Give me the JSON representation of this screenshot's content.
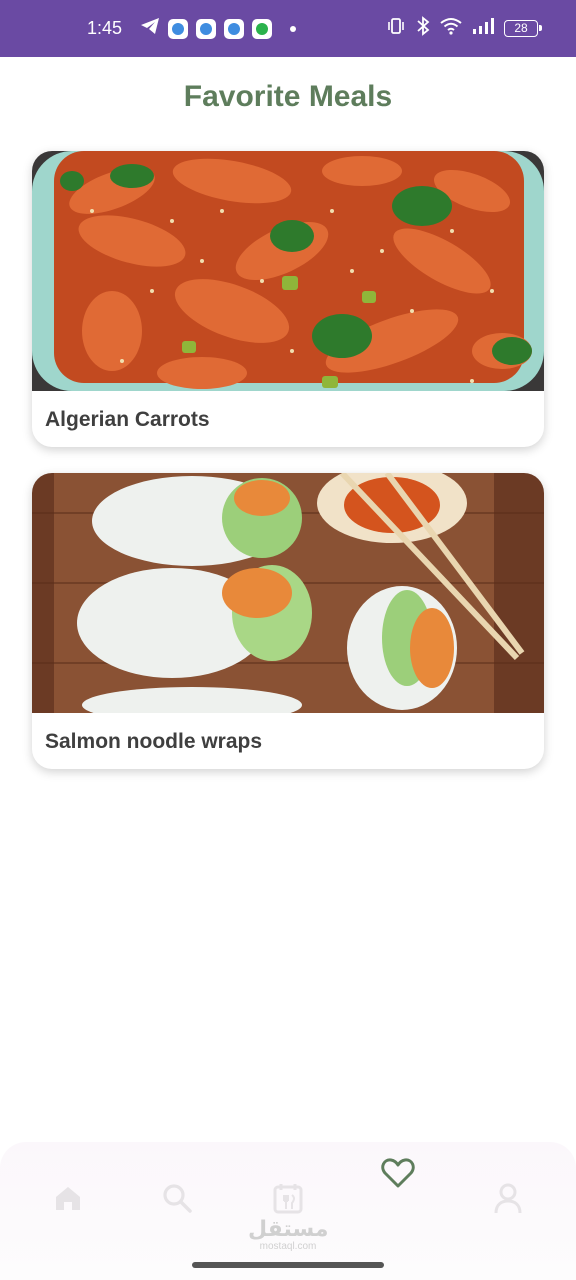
{
  "status_bar": {
    "time": "1:45",
    "battery": "28",
    "icons": [
      "telegram-icon",
      "app-icon",
      "app-icon",
      "app-icon",
      "spotify-icon",
      "vibrate-icon",
      "bluetooth-icon",
      "wifi-icon",
      "signal-icon",
      "battery-icon"
    ]
  },
  "header": {
    "title": "Favorite Meals"
  },
  "meals": [
    {
      "name": "Algerian Carrots"
    },
    {
      "name": "Salmon noodle wraps"
    }
  ],
  "bottom_nav": {
    "items": [
      "home-icon",
      "search-icon",
      "calendar-icon",
      "heart-icon",
      "profile-icon"
    ],
    "active": "heart-icon"
  },
  "watermark": {
    "main": "مستقل",
    "sub": "mostaql.com"
  },
  "colors": {
    "status_bar": "#6a4aa3",
    "title": "#5e7d5c",
    "nav_active": "#5e7d5c",
    "nav_inactive": "#e6e3e6"
  }
}
